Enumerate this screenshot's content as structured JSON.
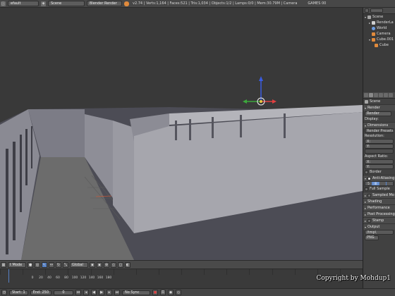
{
  "topbar": {
    "screen_layout": "efault",
    "scene_name": "Scene",
    "render_engine": "Blender Render",
    "stats": "v2.74 | Verts:1,164 | Faces:521 | Tris:1,034 | Objects:1/2 | Lamps:0/0 | Mem:30.79M | Camera",
    "version": "GAMES 00"
  },
  "outliner": {
    "items": [
      {
        "label": "Scene",
        "indent": 0,
        "color": "#a6a6a6"
      },
      {
        "label": "RenderLa",
        "indent": 1,
        "color": "#cfcfcf"
      },
      {
        "label": "World",
        "indent": 1,
        "color": "#6a9be0"
      },
      {
        "label": "Camera",
        "indent": 1,
        "color": "#e08a3c"
      },
      {
        "label": "Cube.001",
        "indent": 1,
        "color": "#e08a3c"
      },
      {
        "label": "Cube",
        "indent": 2,
        "color": "#e08a3c"
      }
    ]
  },
  "properties": {
    "scene_label": "Scene",
    "render_panel": "Render",
    "render_button": "Render",
    "display_label": "Display:",
    "dimensions_panel": "Dimensions",
    "render_presets": "Render Presets",
    "resolution_label": "Resolution:",
    "res_x": "X:",
    "res_y": "Y:",
    "aspect_label": "Aspect Ratio:",
    "aspect_x": "X:",
    "aspect_y": "Y:",
    "border_label": "Border",
    "anti_aliasing": "Anti-Aliasing",
    "aa_values": [
      "5",
      "8"
    ],
    "full_sample": "Full Sample",
    "sampled_motion": "Sampled Mo",
    "shading": "Shading",
    "performance": "Performance",
    "post_processing": "Post Processing",
    "stamp": "Stamp",
    "output": "Output",
    "output_path": "/tmp\\",
    "file_format": "PNG"
  },
  "viewport_header": {
    "mode": "t Mode",
    "orientation": "Global"
  },
  "timeline": {
    "tick_labels": [
      "-40",
      "-20",
      "0",
      "20",
      "40",
      "60",
      "80",
      "100",
      "120",
      "140",
      "160",
      "180",
      "200",
      "220",
      "240",
      "260"
    ],
    "marker_label": "Marker",
    "frame_label": "Frame",
    "playback_label": "Playback",
    "start": "Start:",
    "start_value": "1",
    "end": "End:",
    "end_value": "250",
    "current_frame": "0",
    "sync": "No Sync"
  },
  "watermark": "Copyright by Mohdup1",
  "colors": {
    "axis_x": "#e04040",
    "axis_y": "#3ca83c",
    "axis_z": "#3a5ce0",
    "pivot": "#e8c840",
    "accent": "#5680c2"
  }
}
